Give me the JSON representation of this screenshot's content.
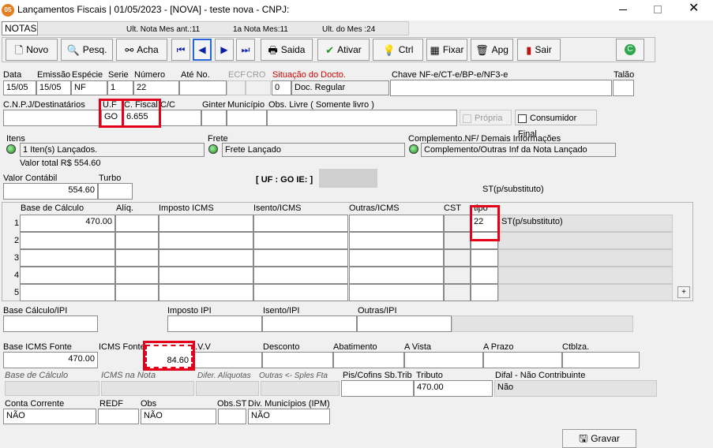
{
  "window": {
    "title": "Lançamentos Fiscais | 01/05/2023 - [NOVA] - teste nova - CNPJ:",
    "app_icon": "05"
  },
  "info": {
    "section": "NOTAS",
    "ult_nota_label": "Ult. Nota Mes ant.:",
    "ult_nota_value": "11",
    "primeira_label": "1a Nota Mes:",
    "primeira_value": "11",
    "ult_mes_label": "Ult. do Mes :",
    "ult_mes_value": "24"
  },
  "toolbar": {
    "novo": "Novo",
    "pesq": "Pesq.",
    "acha": "Acha",
    "saida": "Saida",
    "ativar": "Ativar",
    "ctrl": "Ctrl",
    "fixar": "Fixar",
    "apg": "Apg",
    "sair": "Sair"
  },
  "row1": {
    "data_label": "Data",
    "data": "15/05",
    "emissao_label": "Emissão",
    "emissao": "15/05",
    "especie_label": "Espécie",
    "especie": "NF",
    "serie_label": "Serie",
    "serie": "1",
    "numero_label": "Número",
    "numero": "22",
    "ate_label": "Até No.",
    "ecf_label": "ECF",
    "cro_label": "CRO",
    "situacao_label": "Situação do Docto.",
    "situacao_code": "0",
    "situacao": "Doc. Regular",
    "chave_label": "Chave NF-e/CT-e/BP-e/NF3-e",
    "talao_label": "Talão"
  },
  "row2": {
    "cnpj_label": "C.N.P.J/Destinatários",
    "uf_label": "U.F",
    "uf": "GO",
    "cfiscal_label": "C. Fiscal",
    "cfiscal": "6.655",
    "cc_label": "C/C",
    "ginter_label": "Ginter",
    "municipio_label": "Município",
    "obs_label": "Obs. Livre ( Somente livro )",
    "propria": "Própria",
    "consumidor": "Consumidor Final"
  },
  "row3": {
    "itens_label": "Itens",
    "itens": "1 Iten(s) Lançados.",
    "valor_total": "Valor total R$ 554.60",
    "frete_label": "Frete",
    "frete": "Frete Lançado",
    "compl_label": "Complemento.NF/ Demais Informações",
    "compl": "Complemento/Outras Inf da Nota Lançado"
  },
  "valor": {
    "contabil_label": "Valor Contábil",
    "contabil": "554.60",
    "turbo_label": "Turbo",
    "uf_ie": "[ UF : GO IE: ]",
    "st_label": "ST(p/substituto)"
  },
  "grid": {
    "headers": {
      "base": "Base de Cálculo",
      "aliq": "Alíq.",
      "imposto": "Imposto ICMS",
      "isento": "Isento/ICMS",
      "outras": "Outras/ICMS",
      "cst": "CST",
      "tipo": "tipo"
    },
    "rows": [
      {
        "n": "1.",
        "base": "470.00",
        "tipo": "22",
        "desc": "ST(p/substituto)"
      },
      {
        "n": "2.",
        "base": "",
        "tipo": "",
        "desc": ""
      },
      {
        "n": "3.",
        "base": "",
        "tipo": "",
        "desc": ""
      },
      {
        "n": "4.",
        "base": "",
        "tipo": "",
        "desc": ""
      },
      {
        "n": "5.",
        "base": "",
        "tipo": "",
        "desc": ""
      }
    ],
    "plus": "+"
  },
  "ipi": {
    "base_label": "Base Cálculo/IPI",
    "imposto_label": "Imposto IPI",
    "isento_label": "Isento/IPI",
    "outras_label": "Outras/IPI"
  },
  "fonte": {
    "base_label": "Base ICMS Fonte",
    "base": "470.00",
    "icms_label": "ICMS Fonte",
    "icms": "84.60",
    "ivv_label": "I.V.V",
    "desconto_label": "Desconto",
    "abatimento_label": "Abatimento",
    "avista_label": "A Vista",
    "aprazo_label": "A Prazo",
    "ctblza_label": "Ctblza."
  },
  "calc": {
    "base_label": "Base de Cálculo",
    "icms_nota_label": "ICMS na Nota",
    "difer_label": "Difer. Alíquotas",
    "outras_label": "Outras <- Sples Fta",
    "pis_label": "Pis/Cofins Sb.Trib",
    "tributo_label": "Tributo",
    "tributo": "470.00",
    "difal_label": "Difal - Não Contribuinte",
    "difal": "Não"
  },
  "bottom": {
    "conta_label": "Conta Corrente",
    "conta": "NÃO",
    "redf_label": "REDF",
    "obs_label": "Obs",
    "obs": "NÃO",
    "obsst_label": "Obs.ST",
    "div_label": "Div. Municípios (IPM)",
    "div": "NÃO",
    "gravar": "Gravar"
  }
}
